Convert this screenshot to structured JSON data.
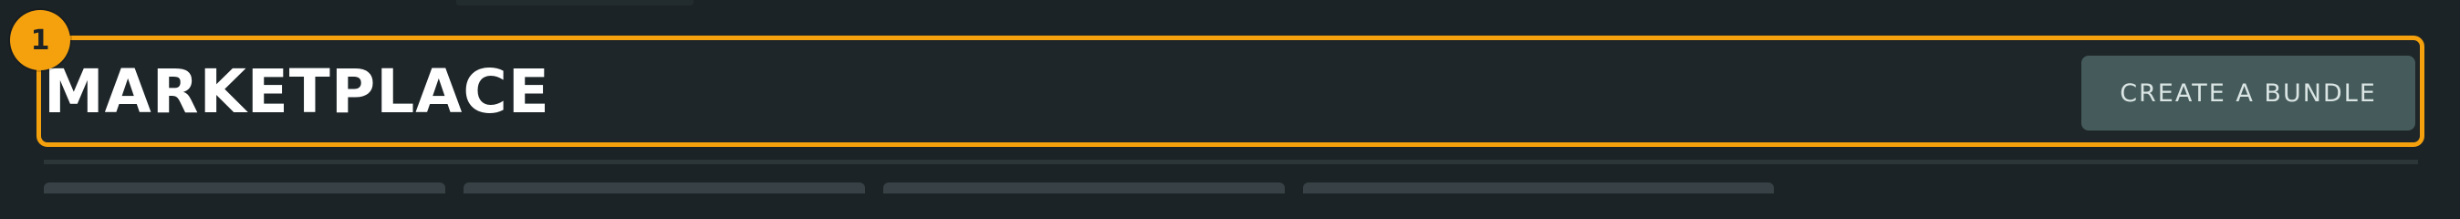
{
  "marker": {
    "label": "1"
  },
  "header": {
    "title": "MARKETPLACE",
    "create_bundle_label": "CREATE A BUNDLE"
  },
  "colors": {
    "highlight": "#f5a00d",
    "background": "#1c2326",
    "button": "#455b5b"
  }
}
